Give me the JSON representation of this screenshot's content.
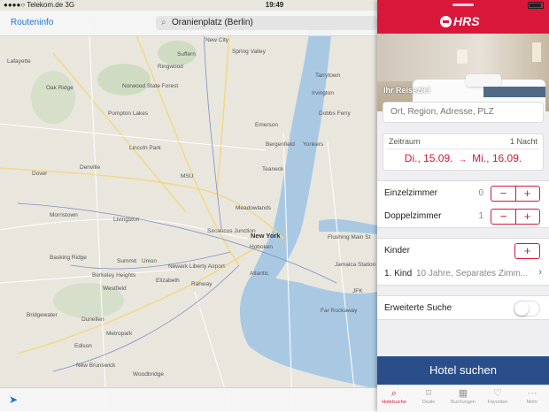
{
  "status": {
    "carrier": "●●●●○ Telekom.de",
    "network": "3G",
    "time": "19:49",
    "battery": "84%"
  },
  "maps": {
    "back_label": "Routeninfo",
    "search_value": "Oranienplatz (Berlin)",
    "labels": {
      "new_city": "New City",
      "suffern": "Suffern",
      "spring_valley": "Spring Valley",
      "lafayette": "Lafayette",
      "ringwood": "Ringwood",
      "tarrytown": "Tarrytown",
      "oak_ridge": "Oak Ridge",
      "norwood": "Norwood State Forest",
      "irvington": "Irvington",
      "pompton": "Pompton Lakes",
      "dobbs": "Dobbs Ferry",
      "emerson": "Emerson",
      "lincoln": "Lincoln Park",
      "bergenfield": "Bergenfield",
      "yonkers": "Yonkers",
      "denville": "Denville",
      "dover": "Dover",
      "teaneck": "Teaneck",
      "msu": "MSU",
      "morristown": "Morristown",
      "meadowlands": "Meadowlands",
      "livingston": "Livingston",
      "secaucus": "Secaucus Junction",
      "new_york": "New York",
      "flushing": "Flushing Main St",
      "hoboken": "Hoboken",
      "basking": "Basking Ridge",
      "summit": "Summit",
      "union": "Union",
      "newark": "Newark Liberty Airport",
      "jamaica": "Jamaica Station",
      "berkeley": "Berkeley Heights",
      "elizabeth": "Elizabeth",
      "atlantic": "Atlantic",
      "westfield": "Westfield",
      "rahway": "Rahway",
      "jfk": "JFK",
      "far_rockaway": "Far Rockaway",
      "bridgewater": "Bridgewater",
      "dunellen": "Dunellen",
      "metropark": "Metropark",
      "edison": "Edison",
      "new_brunswick": "New Brunswick",
      "woodbridge": "Woodbridge"
    }
  },
  "hrs": {
    "logo": "HRS",
    "hero_label": "Ihr Reiseziel",
    "destination_placeholder": "Ort, Region, Adresse, PLZ",
    "zeitraum_label": "Zeitraum",
    "nights": "1 Nacht",
    "checkin": "Di., 15.09.",
    "arrow": "→",
    "checkout": "Mi., 16.09.",
    "single_label": "Einzelzimmer",
    "single_count": "0",
    "double_label": "Doppelzimmer",
    "double_count": "1",
    "kinder_label": "Kinder",
    "kind_label": "1. Kind",
    "kind_detail": "10 Jahre, Separates Zimm...",
    "extended_label": "Erweiterte Suche",
    "extended_on": false,
    "cta": "Hotel suchen",
    "tabs": [
      {
        "label": "Hotelsuche",
        "icon": "magnifier-icon"
      },
      {
        "label": "Deals",
        "icon": "tag-icon"
      },
      {
        "label": "Buchungen",
        "icon": "calendar-icon"
      },
      {
        "label": "Favoriten",
        "icon": "heart-icon"
      },
      {
        "label": "Mehr",
        "icon": "more-icon"
      }
    ],
    "minus": "−",
    "plus": "+",
    "chevron": "›"
  },
  "colors": {
    "brand": "#d8173a",
    "cta": "#2a4e89",
    "link": "#1a73d9"
  }
}
